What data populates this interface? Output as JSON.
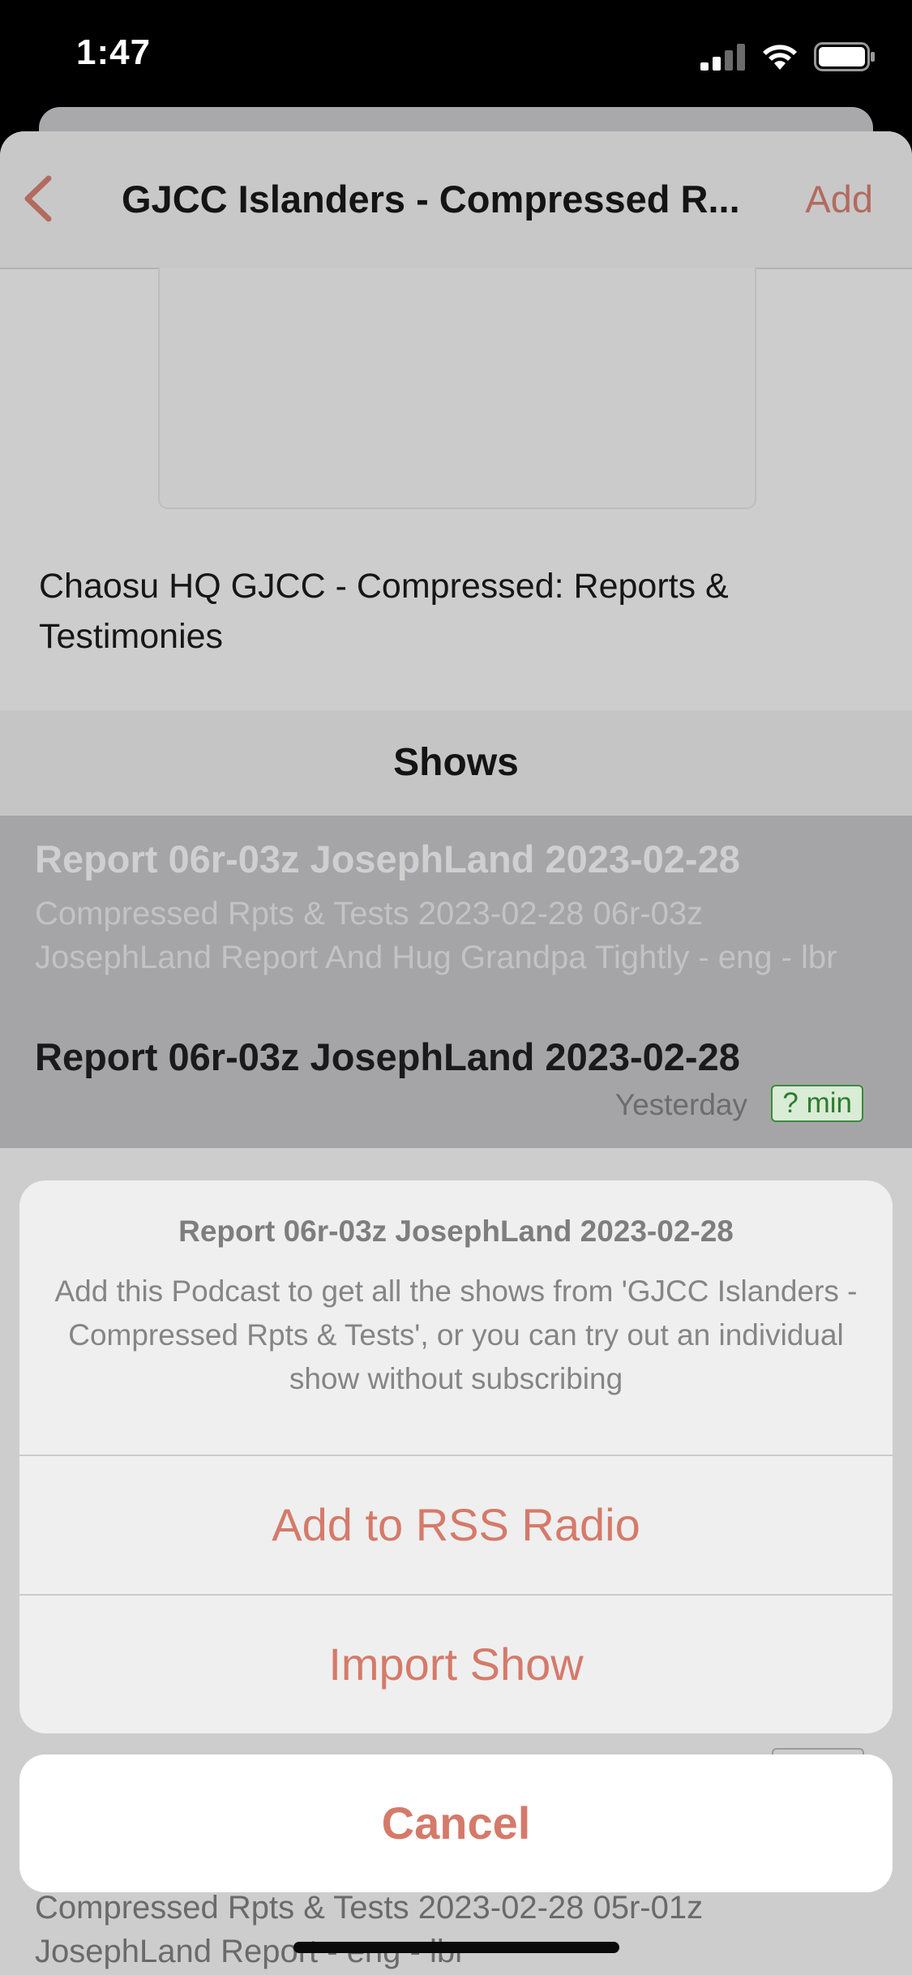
{
  "status_bar": {
    "time": "1:47"
  },
  "nav": {
    "title": "GJCC Islanders - Compressed R...",
    "add_label": "Add"
  },
  "podcast": {
    "description": "Chaosu HQ GJCC - Compressed: Reports & Testimonies"
  },
  "shows_header": "Shows",
  "shows": [
    {
      "title": "Report 06r-03z JosephLand 2023-02-28",
      "description": "Compressed Rpts & Tests 2023-02-28 06r-03z JosephLand Report And Hug Grandpa Tightly - eng - lbr",
      "date": "Yesterday",
      "duration": "? min"
    },
    {
      "title": "Report 06r-03z JosephLand 2023-02-28"
    }
  ],
  "bottom_row": {
    "description": "Compressed Rpts & Tests 2023-02-28 05r-01z JosephLand Report - eng - lbr"
  },
  "action_sheet": {
    "title": "Report 06r-03z JosephLand 2023-02-28",
    "message": "Add this Podcast to get all the shows from 'GJCC Islanders - Compressed Rpts & Tests', or you can try out an individual show without subscribing",
    "add_button": "Add to RSS Radio",
    "import_button": "Import Show",
    "cancel_button": "Cancel"
  },
  "colors": {
    "accent": "#d57a6a",
    "nav_accent": "#b36a5f",
    "badge_green": "#3b8c3b"
  }
}
